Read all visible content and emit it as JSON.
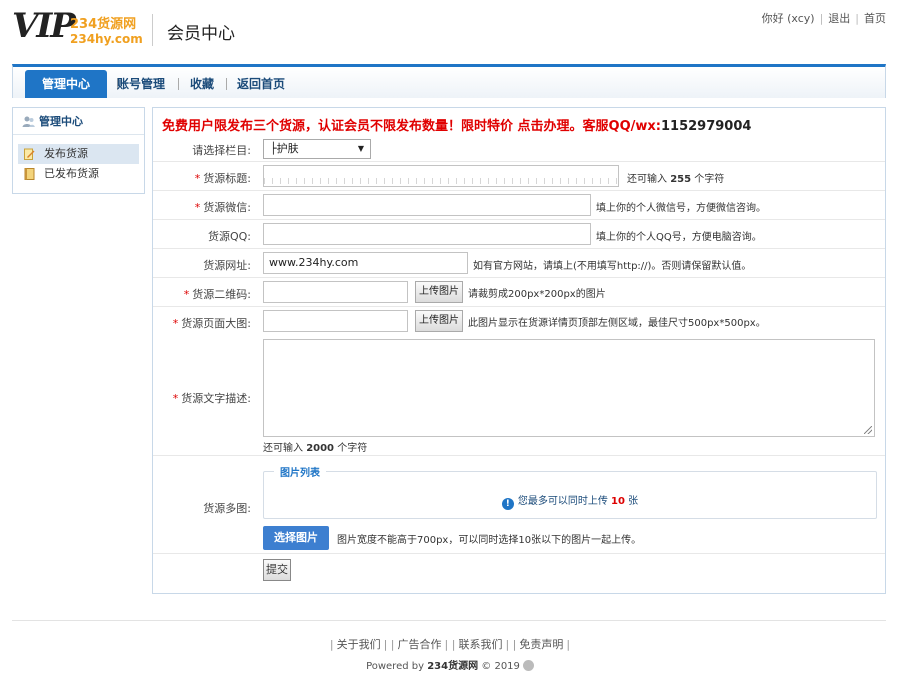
{
  "header": {
    "logo_vip": "VIP",
    "logo_cn": "234货源网",
    "logo_domain": "234hy.com",
    "title": "会员中心",
    "greeting": "你好 (xcy)",
    "logout": "退出",
    "home": "首页"
  },
  "nav": {
    "tabs": [
      {
        "label": "管理中心",
        "active": true
      },
      {
        "label": "账号管理",
        "active": false
      },
      {
        "label": "收藏",
        "active": false
      },
      {
        "label": "返回首页",
        "active": false
      }
    ]
  },
  "sidebar": {
    "title": "管理中心",
    "items": [
      {
        "label": "发布货源",
        "active": true
      },
      {
        "label": "已发布货源",
        "active": false
      }
    ]
  },
  "form": {
    "notice": "免费用户限发布三个货源，认证会员不限发布数量！限时特价 点击办理。客服QQ/wx:",
    "notice_qq": "1152979004",
    "category": {
      "label": "请选择栏目:",
      "value": "├护肤"
    },
    "title_field": {
      "label": "货源标题:",
      "value": "",
      "hint_pre": "还可输入",
      "hint_count": "255",
      "hint_post": "个字符"
    },
    "wechat": {
      "label": "货源微信:",
      "value": "",
      "hint": "填上你的个人微信号，方便微信咨询。"
    },
    "qq": {
      "label": "货源QQ:",
      "value": "",
      "hint": "填上你的个人QQ号，方便电脑咨询。"
    },
    "website": {
      "label": "货源网址:",
      "value": "www.234hy.com",
      "hint": "如有官方网站，请填上(不用填写http://)。否则请保留默认值。"
    },
    "qrcode": {
      "label": "货源二维码:",
      "button": "上传图片",
      "hint": "请裁剪成200px*200px的图片"
    },
    "banner": {
      "label": "货源页面大图:",
      "button": "上传图片",
      "hint": "此图片显示在货源详情页顶部左侧区域，最佳尺寸500px*500px。"
    },
    "description": {
      "label": "货源文字描述:",
      "hint_pre": "还可输入",
      "hint_count": "2000",
      "hint_post": "个字符"
    },
    "images": {
      "label": "货源多图:",
      "legend": "图片列表",
      "info_pre": "您最多可以同时上传",
      "info_count": "10",
      "info_post": "张",
      "button": "选择图片",
      "hint": "图片宽度不能高于700px，可以同时选择10张以下的图片一起上传。"
    },
    "submit": "提交"
  },
  "footer": {
    "links": [
      "关于我们",
      "广告合作",
      "联系我们",
      "免责声明"
    ],
    "powered_pre": "Powered by",
    "powered_brand": "234货源网",
    "powered_post": "© 2019"
  },
  "colors": {
    "accent": "#1f75c6",
    "notice": "#e00000",
    "border": "#c8d8e8"
  }
}
